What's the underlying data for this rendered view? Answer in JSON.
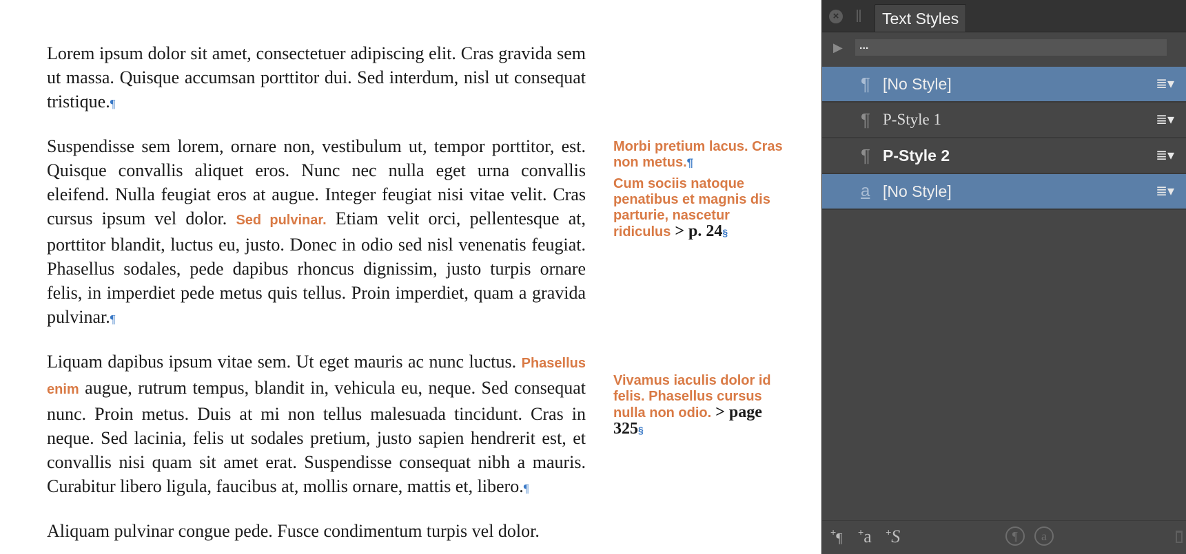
{
  "doc": {
    "p1": "Lorem ipsum dolor sit amet, consectetuer adipiscing elit. Cras gravida sem ut massa. Quisque accumsan porttitor dui. Sed interdum, nisl ut consequat tristique.",
    "p2a": "Suspendisse sem lorem, ornare non, vestibulum ut, tempor porttitor, est. Quisque convallis aliquet eros. Nunc nec nulla eget urna convallis eleifend. Nulla feugiat eros at augue. Integer feugiat nisi vitae velit. Cras cursus ipsum vel dolor. ",
    "p2_hl": "Sed pulvinar.",
    "p2b": " Etiam velit orci, pellentesque at, porttitor blandit, luctus eu, justo. Donec in odio sed nisl venenatis feugiat. Phasellus sodales, pede dapibus rhoncus dignissim, justo turpis ornare felis, in imperdiet pede metus quis tellus. Proin imperdiet, quam a gravida pulvinar.",
    "p3a": "Liquam dapibus ipsum vitae sem. Ut eget mauris ac nunc luctus. ",
    "p3_hl": "Phasellus enim",
    "p3b": " augue, rutrum tempus, blandit in, vehicula eu, neque. Sed consequat nunc. Proin metus. Duis at mi non tellus malesuada tincidunt. Cras in neque. Sed lacinia, felis ut sodales pretium, justo sapien hendrerit est, et convallis nisi quam sit amet erat. Suspendisse consequat nibh a mauris. Curabitur libero ligula, faucibus at, mollis ornare, mattis et, libero.",
    "p4": "Aliquam pulvinar congue pede. Fusce condimentum turpis vel dolor.",
    "pilcrow": "¶",
    "section_mark": "§",
    "side1_a": "Morbi pretium lacus. Cras non metus.",
    "side1_b": "Cum sociis natoque penatibus et magnis dis parturie, nascetur ridiculus",
    "side1_ref": " > p. 24",
    "side2": "Vivamus iaculis dolor id felis. Phasellus cursus nulla non odio.",
    "side2_ref": " > page 325"
  },
  "panel": {
    "tab_title": "Text Styles",
    "close_glyph": "×",
    "path_text": "...",
    "play_glyph": "▶",
    "styles": [
      {
        "symbol": "¶",
        "name": "[No Style]",
        "selected": true
      },
      {
        "symbol": "¶",
        "name": "P-Style 1",
        "selected": false
      },
      {
        "symbol": "¶",
        "name": "P-Style 2",
        "selected": false
      },
      {
        "symbol": "a",
        "name": "[No Style]",
        "selected": true
      }
    ],
    "menu_glyph": "≣▾",
    "footer": {
      "new_para": "¶",
      "new_char": "a",
      "new_obj": "S",
      "plus": "+",
      "clear_para": "¶",
      "clear_char": "a"
    }
  },
  "colors": {
    "highlight": "#d97a45",
    "selection": "#5b7fa8",
    "panel_bg": "#464646",
    "hidden_chars": "#3a79c6"
  }
}
